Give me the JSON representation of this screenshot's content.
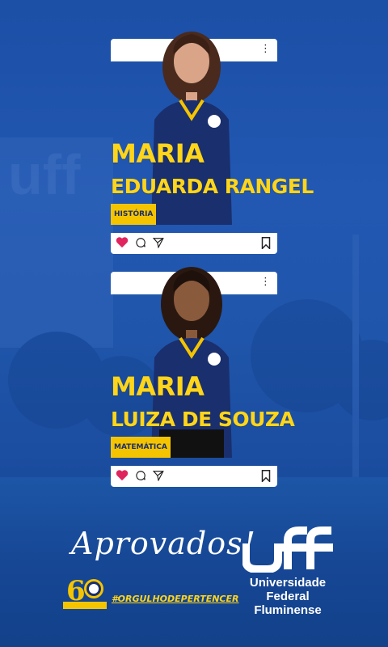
{
  "posts": [
    {
      "first_name": "MARIA",
      "last_name": "EDUARDA RANGEL",
      "course": "HISTÓRIA"
    },
    {
      "first_name": "MARIA",
      "last_name": "LUIZA DE SOUZA",
      "course": "MATEMÁTICA"
    }
  ],
  "headline": "Aprovados!",
  "hashtag": "#ORGULHODEPERTENCER",
  "university": {
    "line1": "Universidade",
    "line2": "Federal",
    "line3": "Fluminense"
  },
  "colors": {
    "background": "#1d52a8",
    "accent_yellow": "#ffd51a",
    "course_tag": "#f5c400",
    "card": "#ffffff",
    "like_heart": "#e0245e"
  },
  "icons": [
    "more-vertical-icon",
    "heart-icon",
    "comment-icon",
    "send-icon",
    "bookmark-icon"
  ]
}
